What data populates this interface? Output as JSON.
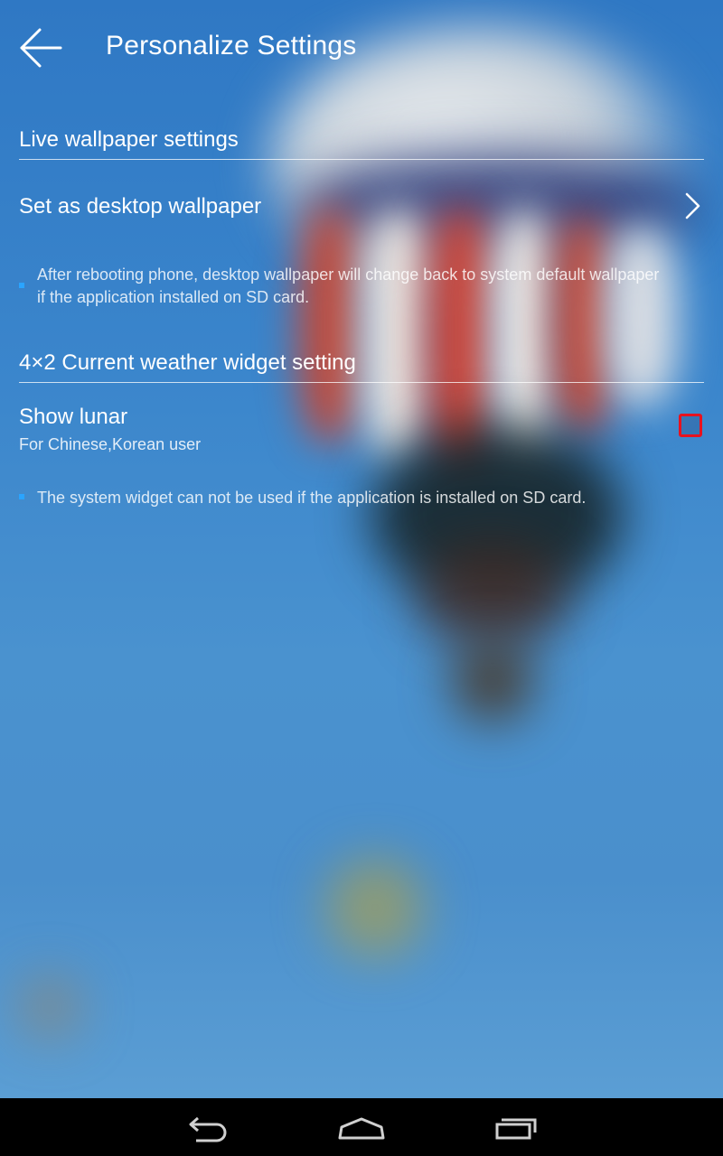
{
  "header": {
    "back_icon": "arrow-left-icon",
    "title": "Personalize Settings"
  },
  "sections": [
    {
      "title": "Live wallpaper settings",
      "rows": [
        {
          "title": "Set as desktop wallpaper",
          "icon": "chevron-right-icon"
        }
      ],
      "note": "After rebooting phone, desktop wallpaper will change back to system default wallpaper if the application installed on SD card."
    },
    {
      "title": "4×2 Current weather widget setting",
      "rows": [
        {
          "title": "Show lunar",
          "subtitle": "For Chinese,Korean user",
          "checked": false
        }
      ],
      "note": "The system widget can not be used if the application is installed on SD card."
    }
  ],
  "navbar": {
    "back_icon": "nav-back-icon",
    "home_icon": "nav-home-icon",
    "recents_icon": "nav-recents-icon"
  },
  "colors": {
    "checkbox_border": "#e8121f",
    "bullet": "#2aa4ff",
    "navbar": "#000000"
  }
}
